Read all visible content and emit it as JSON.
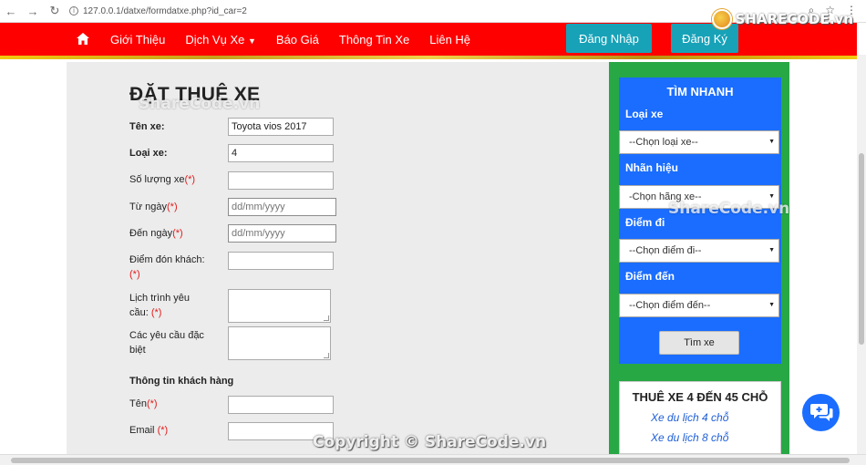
{
  "browser": {
    "url": "127.0.0.1/datxe/formdatxe.php?id_car=2"
  },
  "brand": {
    "logo_text": "SHARECODE.vn"
  },
  "nav": {
    "items": [
      "Giới Thiệu",
      "Dịch Vụ Xe",
      "Báo Giá",
      "Thông Tin Xe",
      "Liên Hệ"
    ],
    "login": "Đăng Nhập",
    "register": "Đăng Ký"
  },
  "form": {
    "title": "ĐẶT THUÊ XE",
    "car_name_label": "Tên xe:",
    "car_name_value": "Toyota vios 2017",
    "car_type_label": "Loại xe:",
    "car_type_value": "4",
    "quantity_label": "Số lượng xe",
    "from_date_label": "Từ ngày",
    "from_date_placeholder": "dd/mm/yyyy",
    "to_date_label": "Đến ngày",
    "to_date_placeholder": "dd/mm/yyyy",
    "pickup_label": "Điểm đón khách:",
    "itinerary_label_1": "Lịch trình yêu",
    "itinerary_label_2": "cầu:",
    "requests_label_1": "Các yêu cầu đặc",
    "requests_label_2": "biệt",
    "customer_section": "Thông tin khách hàng",
    "name_label": "Tên",
    "email_label": "Email ",
    "required_mark": "(*)"
  },
  "quick_search": {
    "title": "TÌM NHANH",
    "car_type_label": "Loại xe",
    "car_type_select": "--Chọn loại xe--",
    "brand_label": "Nhãn hiệu",
    "brand_select": "-Chọn hãng xe--",
    "from_label": "Điểm đi",
    "from_select": "--Chọn điểm đi--",
    "to_label": "Điểm đến",
    "to_select": "--Chọn điểm đến--",
    "button": "Tìm xe"
  },
  "rental": {
    "title": "THUÊ XE 4 ĐẾN 45 CHỖ",
    "links": [
      "Xe du lịch 4 chỗ",
      "Xe du lịch 8 chỗ"
    ]
  },
  "watermarks": [
    "ShareCode.vn",
    "ShareCode.vn",
    "Copyright © ShareCode.vn"
  ],
  "colors": {
    "navbar": "#ff0000",
    "sidebar": "#28a745",
    "search": "#1a6dff",
    "nav_button": "#17a2b8"
  }
}
